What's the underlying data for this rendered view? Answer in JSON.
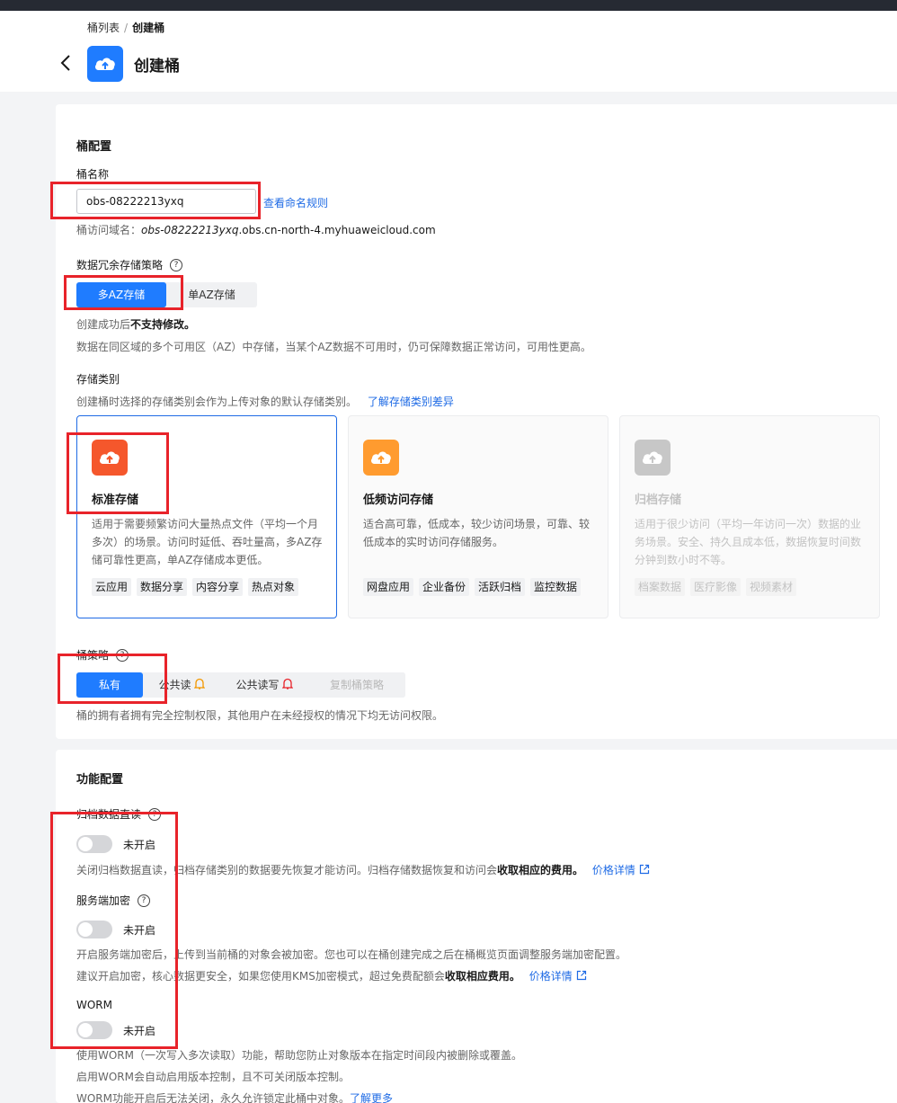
{
  "breadcrumb": {
    "parent": "桶列表",
    "separator": "/",
    "current": "创建桶"
  },
  "page": {
    "title": "创建桶"
  },
  "bucket_config": {
    "section_title": "桶配置",
    "name_label": "桶名称",
    "name_value": "obs-08222213yxq",
    "naming_rules_link": "查看命名规则",
    "domain_prefix": "桶访问域名：",
    "domain_italic": "obs-08222213yxq",
    "domain_suffix": ".obs.cn-north-4.myhuaweicloud.com",
    "redundancy_label": "数据冗余存储策略",
    "redundancy_options": [
      "多AZ存储",
      "单AZ存储"
    ],
    "redundancy_note_prefix": "创建成功后",
    "redundancy_note_bold": "不支持修改。",
    "redundancy_desc": "数据在同区域的多个可用区（AZ）中存储，当某个AZ数据不可用时，仍可保障数据正常访问，可用性更高。",
    "storage_class_label": "存储类别",
    "storage_class_desc": "创建桶时选择的存储类别会作为上传对象的默认存储类别。",
    "storage_class_link": "了解存储类别差异",
    "storage_classes": [
      {
        "name": "标准存储",
        "desc": "适用于需要频繁访问大量热点文件（平均一个月多次）的场景。访问时延低、吞吐量高，多AZ存储可靠性更高，单AZ存储成本更低。",
        "tags": [
          "云应用",
          "数据分享",
          "内容分享",
          "热点对象"
        ]
      },
      {
        "name": "低频访问存储",
        "desc": "适合高可靠，低成本，较少访问场景，可靠、较低成本的实时访问存储服务。",
        "tags": [
          "网盘应用",
          "企业备份",
          "活跃归档",
          "监控数据"
        ]
      },
      {
        "name": "归档存储",
        "desc": "适用于很少访问（平均一年访问一次）数据的业务场景。安全、持久且成本低，数据恢复时间数分钟到数小时不等。",
        "tags": [
          "档案数据",
          "医疗影像",
          "视频素材"
        ]
      }
    ],
    "policy_label": "桶策略",
    "policy_options": [
      "私有",
      "公共读",
      "公共读写",
      "复制桶策略"
    ],
    "policy_desc": "桶的拥有者拥有完全控制权限，其他用户在未经授权的情况下均无访问权限。"
  },
  "feature_config": {
    "section_title": "功能配置",
    "archive_label": "归档数据直读",
    "archive_status": "未开启",
    "archive_desc_prefix": "关闭归档数据直读，归档存储类别的数据要先恢复才能访问。归档存储数据恢复和访问会",
    "archive_desc_bold": "收取相应的费用。",
    "archive_link": "价格详情",
    "encryption_label": "服务端加密",
    "encryption_status": "未开启",
    "encryption_desc1": "开启服务端加密后，上传到当前桶的对象会被加密。您也可以在桶创建完成之后在桶概览页面调整服务端加密配置。",
    "encryption_desc2_prefix": "建议开启加密，核心数据更安全，如果您使用KMS加密模式，超过免费配额会",
    "encryption_desc2_bold": "收取相应费用。",
    "encryption_link": "价格详情",
    "worm_label": "WORM",
    "worm_status": "未开启",
    "worm_desc1": "使用WORM（一次写入多次读取）功能，帮助您防止对象版本在指定时间段内被删除或覆盖。",
    "worm_desc2": "启用WORM会自动启用版本控制，且不可关闭版本控制。",
    "worm_desc3_prefix": "WORM功能开启后无法关闭，永久允许锁定此桶中对象。",
    "worm_link": "了解更多"
  },
  "colors": {
    "accent": "#1f7cff",
    "link": "#1f6be5",
    "standard_icon": "#f5572c",
    "infrequent_icon": "#ff9b2f",
    "archive_icon": "#c7c7c7",
    "annotation": "#e8232a",
    "bell_orange": "#f39800",
    "bell_red": "#e8232a"
  },
  "icons": {
    "back": "chevron-left-icon",
    "logo": "cloud-upload-icon",
    "help": "question-circle-icon",
    "bell": "bell-icon",
    "external": "external-link-icon"
  }
}
